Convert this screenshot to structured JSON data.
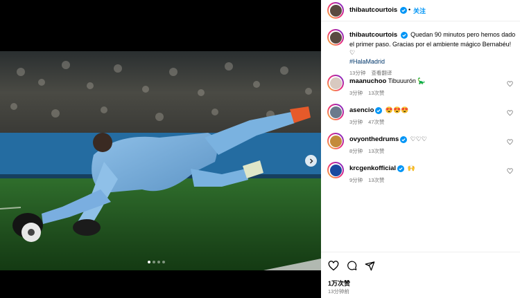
{
  "post": {
    "author": "thibautcourtois",
    "follow_label": "关注",
    "dot": "•",
    "caption": "Quedan 90 minutos pero hemos dado el primer paso. Gracias por el ambiente mágico Bernabéu! ♡",
    "hashtag": "#HalaMadrid",
    "caption_time": "13分钟",
    "see_translation": "查看翻译",
    "likes": "1万次赞",
    "posted_time": "13分钟前"
  },
  "comments": [
    {
      "user": "maanuchoo",
      "verified": false,
      "text": "Tibuuurón 🦕",
      "time": "3分钟",
      "likes": "13次赞",
      "avatar_color": "#d8c9c0"
    },
    {
      "user": "asencio",
      "verified": true,
      "text": "😍😍😍",
      "time": "3分钟",
      "likes": "47次赞",
      "avatar_color": "#6b7a8c"
    },
    {
      "user": "ovyonthedrums",
      "verified": true,
      "text": "♡♡♡",
      "time": "8分钟",
      "likes": "13次赞",
      "avatar_color": "#c48a3a"
    },
    {
      "user": "krcgenkofficial",
      "verified": true,
      "text": "🙌",
      "time": "9分钟",
      "likes": "13次赞",
      "avatar_color": "#1a4aa0"
    }
  ],
  "carousel": {
    "count": 4,
    "active": 0
  },
  "icons": {
    "heart": "heart-icon",
    "comment": "comment-icon",
    "share": "share-icon",
    "next": "chevron-right-icon",
    "verified": "verified-badge-icon"
  },
  "colors": {
    "accent": "#0095f6",
    "verified": "#0095f6",
    "meta": "#737373"
  }
}
